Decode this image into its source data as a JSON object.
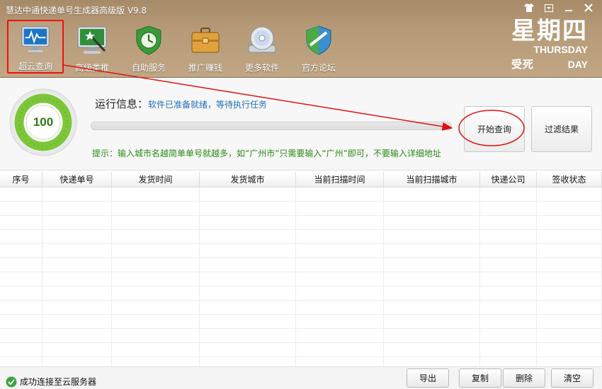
{
  "window": {
    "title": "慧达中通快递单号生成器高级版 V9.8",
    "controls": [
      "shirt-icon",
      "menu-icon",
      "minimize-icon",
      "close-icon"
    ]
  },
  "toolbar": {
    "items": [
      {
        "label": "超云查询",
        "icon": "monitor-pulse-icon",
        "active": true
      },
      {
        "label": "高级类推",
        "icon": "monitor-wand-icon",
        "active": false
      },
      {
        "label": "自助服务",
        "icon": "shield-clock-icon",
        "active": false
      },
      {
        "label": "推广赚钱",
        "icon": "briefcase-icon",
        "active": false
      },
      {
        "label": "更多软件",
        "icon": "disc-icon",
        "active": false
      },
      {
        "label": "官方论坛",
        "icon": "shield-forum-icon",
        "active": false
      }
    ]
  },
  "day": {
    "cn": "星期四",
    "en": "THURSDAY",
    "tag": "受死",
    "en2": "DAY"
  },
  "score": {
    "value": "100",
    "ring_fraction": 1.0
  },
  "run": {
    "label": "运行信息：",
    "message": "软件已准备就绪，等待执行任务",
    "progress": 0
  },
  "tip": "提示：输入城市名越简单单号就越多，如“广州市”只需要输入“广州”即可，不要输入详细地址",
  "buttons": {
    "start": "开始查询",
    "filter": "过滤结果"
  },
  "table": {
    "columns": [
      "序号",
      "快递单号",
      "发货时间",
      "发货城市",
      "当前扫描时间",
      "当前扫描城市",
      "快递公司",
      "签收状态"
    ],
    "rows": []
  },
  "status": {
    "text": "成功连接至云服务器",
    "buttons": {
      "export": "导出",
      "copy": "复制",
      "delete": "删除",
      "clear": "清空"
    }
  },
  "colors": {
    "header": "#b79b78",
    "annotation": "#e11111",
    "tip": "#2a8a16",
    "message": "#1f6fb8"
  }
}
